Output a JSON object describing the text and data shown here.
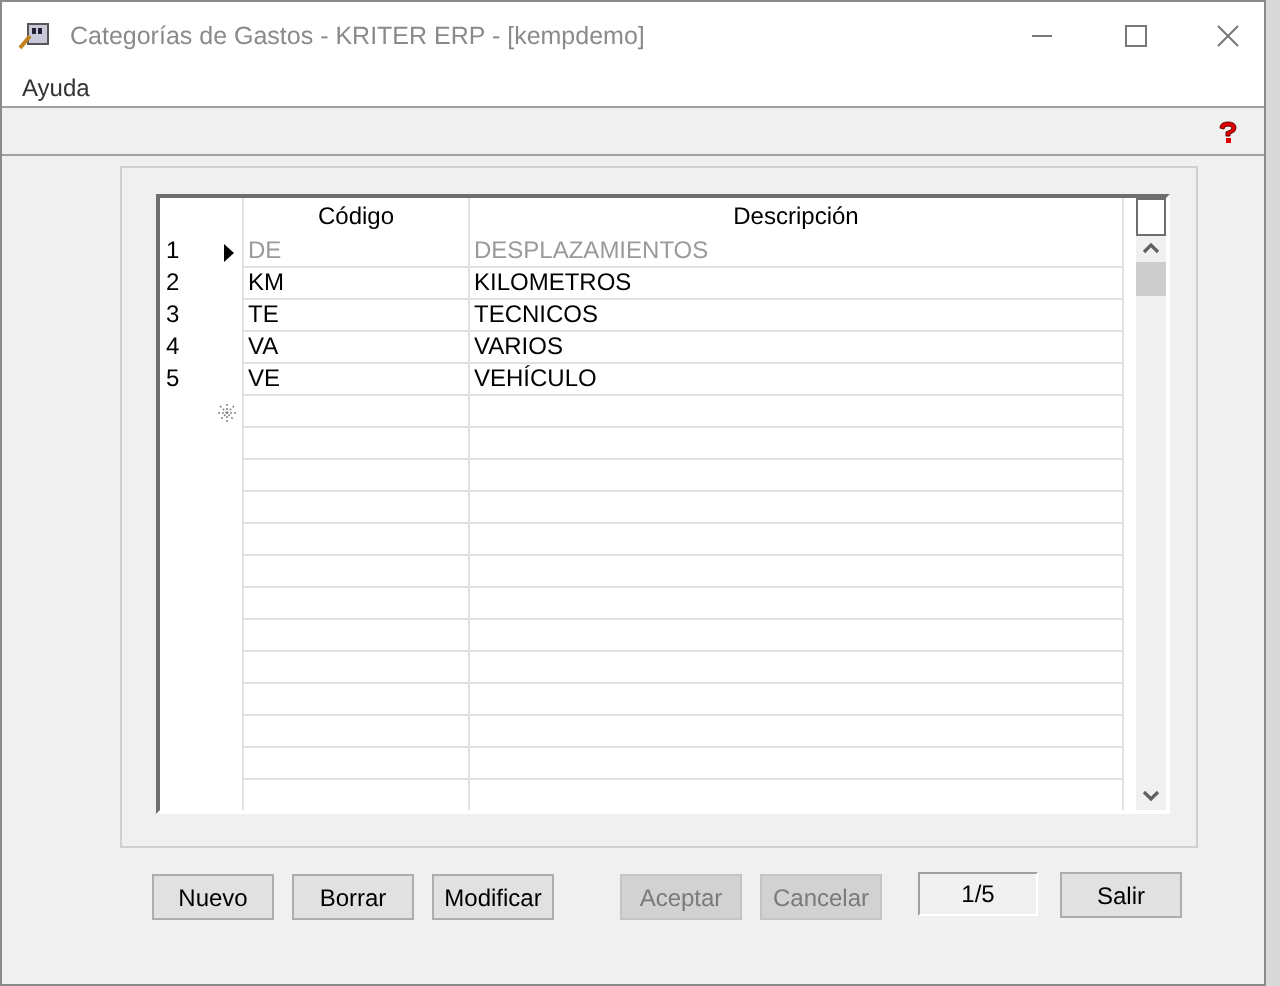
{
  "window": {
    "title": "Categorías de Gastos - KRITER ERP - [kempdemo]"
  },
  "menu": [
    "Ayuda"
  ],
  "table": {
    "columns": [
      "Código",
      "Descripción"
    ],
    "rows": [
      {
        "number": "1",
        "code": "DE",
        "description": "DESPLAZAMIENTOS",
        "selected": true
      },
      {
        "number": "2",
        "code": "KM",
        "description": "KILOMETROS",
        "selected": false
      },
      {
        "number": "3",
        "code": "TE",
        "description": "TECNICOS",
        "selected": false
      },
      {
        "number": "4",
        "code": "VA",
        "description": "VARIOS",
        "selected": false
      },
      {
        "number": "5",
        "code": "VE",
        "description": "VEHÍCULO",
        "selected": false
      }
    ]
  },
  "buttons": [
    {
      "label": "Nuevo",
      "disabled": false
    },
    {
      "label": "Borrar",
      "disabled": false
    },
    {
      "label": "Modificar",
      "disabled": false
    },
    {
      "label": "Aceptar",
      "disabled": true
    },
    {
      "label": "Cancelar",
      "disabled": true
    }
  ],
  "record_counter": "1/5",
  "exit_button": {
    "label": "Salir",
    "disabled": false
  }
}
